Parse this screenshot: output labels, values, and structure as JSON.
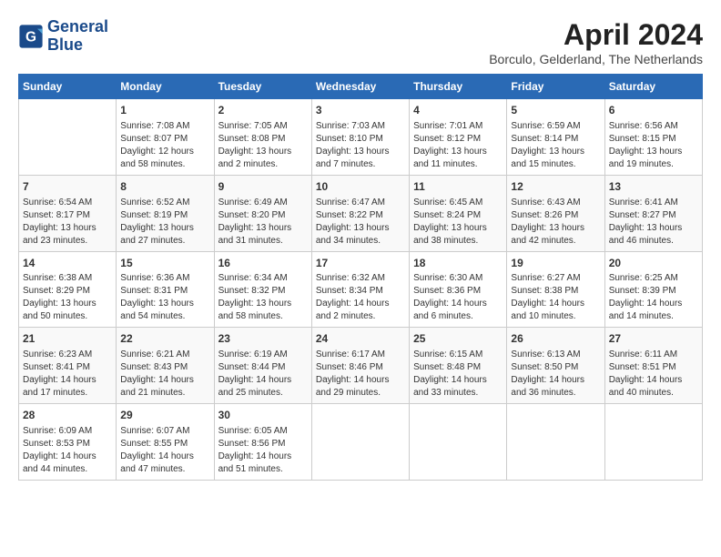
{
  "header": {
    "logo_line1": "General",
    "logo_line2": "Blue",
    "month_title": "April 2024",
    "subtitle": "Borculo, Gelderland, The Netherlands"
  },
  "days_of_week": [
    "Sunday",
    "Monday",
    "Tuesday",
    "Wednesday",
    "Thursday",
    "Friday",
    "Saturday"
  ],
  "weeks": [
    [
      {
        "day": "",
        "info": ""
      },
      {
        "day": "1",
        "info": "Sunrise: 7:08 AM\nSunset: 8:07 PM\nDaylight: 12 hours\nand 58 minutes."
      },
      {
        "day": "2",
        "info": "Sunrise: 7:05 AM\nSunset: 8:08 PM\nDaylight: 13 hours\nand 2 minutes."
      },
      {
        "day": "3",
        "info": "Sunrise: 7:03 AM\nSunset: 8:10 PM\nDaylight: 13 hours\nand 7 minutes."
      },
      {
        "day": "4",
        "info": "Sunrise: 7:01 AM\nSunset: 8:12 PM\nDaylight: 13 hours\nand 11 minutes."
      },
      {
        "day": "5",
        "info": "Sunrise: 6:59 AM\nSunset: 8:14 PM\nDaylight: 13 hours\nand 15 minutes."
      },
      {
        "day": "6",
        "info": "Sunrise: 6:56 AM\nSunset: 8:15 PM\nDaylight: 13 hours\nand 19 minutes."
      }
    ],
    [
      {
        "day": "7",
        "info": "Sunrise: 6:54 AM\nSunset: 8:17 PM\nDaylight: 13 hours\nand 23 minutes."
      },
      {
        "day": "8",
        "info": "Sunrise: 6:52 AM\nSunset: 8:19 PM\nDaylight: 13 hours\nand 27 minutes."
      },
      {
        "day": "9",
        "info": "Sunrise: 6:49 AM\nSunset: 8:20 PM\nDaylight: 13 hours\nand 31 minutes."
      },
      {
        "day": "10",
        "info": "Sunrise: 6:47 AM\nSunset: 8:22 PM\nDaylight: 13 hours\nand 34 minutes."
      },
      {
        "day": "11",
        "info": "Sunrise: 6:45 AM\nSunset: 8:24 PM\nDaylight: 13 hours\nand 38 minutes."
      },
      {
        "day": "12",
        "info": "Sunrise: 6:43 AM\nSunset: 8:26 PM\nDaylight: 13 hours\nand 42 minutes."
      },
      {
        "day": "13",
        "info": "Sunrise: 6:41 AM\nSunset: 8:27 PM\nDaylight: 13 hours\nand 46 minutes."
      }
    ],
    [
      {
        "day": "14",
        "info": "Sunrise: 6:38 AM\nSunset: 8:29 PM\nDaylight: 13 hours\nand 50 minutes."
      },
      {
        "day": "15",
        "info": "Sunrise: 6:36 AM\nSunset: 8:31 PM\nDaylight: 13 hours\nand 54 minutes."
      },
      {
        "day": "16",
        "info": "Sunrise: 6:34 AM\nSunset: 8:32 PM\nDaylight: 13 hours\nand 58 minutes."
      },
      {
        "day": "17",
        "info": "Sunrise: 6:32 AM\nSunset: 8:34 PM\nDaylight: 14 hours\nand 2 minutes."
      },
      {
        "day": "18",
        "info": "Sunrise: 6:30 AM\nSunset: 8:36 PM\nDaylight: 14 hours\nand 6 minutes."
      },
      {
        "day": "19",
        "info": "Sunrise: 6:27 AM\nSunset: 8:38 PM\nDaylight: 14 hours\nand 10 minutes."
      },
      {
        "day": "20",
        "info": "Sunrise: 6:25 AM\nSunset: 8:39 PM\nDaylight: 14 hours\nand 14 minutes."
      }
    ],
    [
      {
        "day": "21",
        "info": "Sunrise: 6:23 AM\nSunset: 8:41 PM\nDaylight: 14 hours\nand 17 minutes."
      },
      {
        "day": "22",
        "info": "Sunrise: 6:21 AM\nSunset: 8:43 PM\nDaylight: 14 hours\nand 21 minutes."
      },
      {
        "day": "23",
        "info": "Sunrise: 6:19 AM\nSunset: 8:44 PM\nDaylight: 14 hours\nand 25 minutes."
      },
      {
        "day": "24",
        "info": "Sunrise: 6:17 AM\nSunset: 8:46 PM\nDaylight: 14 hours\nand 29 minutes."
      },
      {
        "day": "25",
        "info": "Sunrise: 6:15 AM\nSunset: 8:48 PM\nDaylight: 14 hours\nand 33 minutes."
      },
      {
        "day": "26",
        "info": "Sunrise: 6:13 AM\nSunset: 8:50 PM\nDaylight: 14 hours\nand 36 minutes."
      },
      {
        "day": "27",
        "info": "Sunrise: 6:11 AM\nSunset: 8:51 PM\nDaylight: 14 hours\nand 40 minutes."
      }
    ],
    [
      {
        "day": "28",
        "info": "Sunrise: 6:09 AM\nSunset: 8:53 PM\nDaylight: 14 hours\nand 44 minutes."
      },
      {
        "day": "29",
        "info": "Sunrise: 6:07 AM\nSunset: 8:55 PM\nDaylight: 14 hours\nand 47 minutes."
      },
      {
        "day": "30",
        "info": "Sunrise: 6:05 AM\nSunset: 8:56 PM\nDaylight: 14 hours\nand 51 minutes."
      },
      {
        "day": "",
        "info": ""
      },
      {
        "day": "",
        "info": ""
      },
      {
        "day": "",
        "info": ""
      },
      {
        "day": "",
        "info": ""
      }
    ]
  ]
}
